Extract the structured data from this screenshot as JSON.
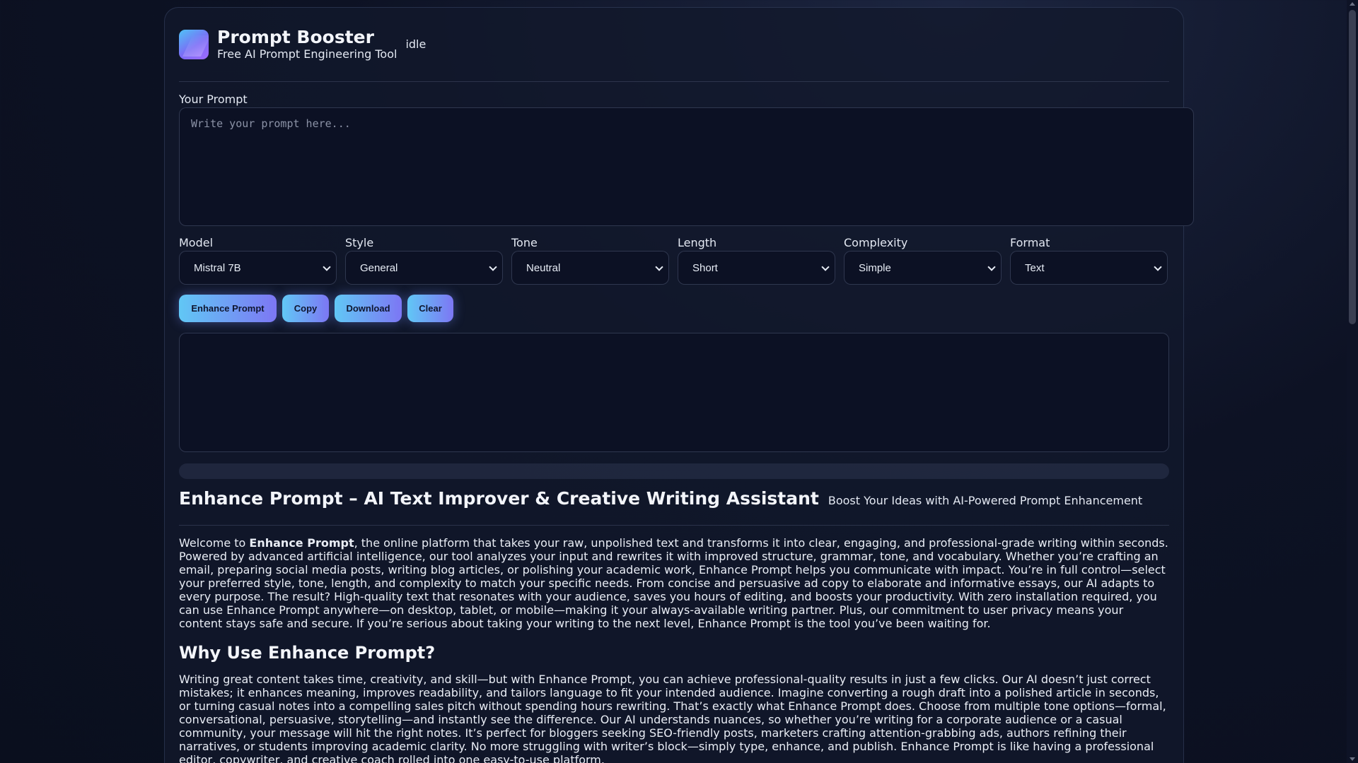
{
  "app": {
    "title": "Prompt Booster",
    "subtitle": "Free AI Prompt Engineering Tool",
    "status": "idle"
  },
  "prompt": {
    "label": "Your Prompt",
    "placeholder": "Write your prompt here...",
    "value": ""
  },
  "options": {
    "model": {
      "label": "Model",
      "value": "Mistral 7B"
    },
    "style": {
      "label": "Style",
      "value": "General"
    },
    "tone": {
      "label": "Tone",
      "value": "Neutral"
    },
    "length": {
      "label": "Length",
      "value": "Short"
    },
    "complexity": {
      "label": "Complexity",
      "value": "Simple"
    },
    "format": {
      "label": "Format",
      "value": "Text"
    }
  },
  "actions": {
    "enhance": "Enhance Prompt",
    "copy": "Copy",
    "download": "Download",
    "clear": "Clear"
  },
  "output": {
    "text": ""
  },
  "progress": {
    "percent": 0
  },
  "article": {
    "title": "Enhance Prompt – AI Text Improver & Creative Writing Assistant",
    "tagline": "Boost Your Ideas with AI-Powered Prompt Enhancement",
    "intro_prefix": "Welcome to ",
    "intro_brand": "Enhance Prompt",
    "intro_body": ", the online platform that takes your raw, unpolished text and transforms it into clear, engaging, and professional-grade writing within seconds. Powered by advanced artificial intelligence, our tool analyzes your input and rewrites it with improved structure, grammar, tone, and vocabulary. Whether you’re crafting an email, preparing social media posts, writing blog articles, or polishing your academic work, Enhance Prompt helps you communicate with impact. You’re in full control—select your preferred style, tone, length, and complexity to match your specific needs. From concise and persuasive ad copy to elaborate and informative essays, our AI adapts to every purpose. The result? High-quality text that resonates with your audience, saves you hours of editing, and boosts your productivity. With zero installation required, you can use Enhance Prompt anywhere—on desktop, tablet, or mobile—making it your always-available writing partner. Plus, our commitment to user privacy means your content stays safe and secure. If you’re serious about taking your writing to the next level, Enhance Prompt is the tool you’ve been waiting for.",
    "section_title": "Why Use Enhance Prompt?",
    "section_body": "Writing great content takes time, creativity, and skill—but with Enhance Prompt, you can achieve professional-quality results in just a few clicks. Our AI doesn’t just correct mistakes; it enhances meaning, improves readability, and tailors language to fit your intended audience. Imagine converting a rough draft into a polished article in seconds, or turning casual notes into a compelling sales pitch without spending hours rewriting. That’s exactly what Enhance Prompt does. Choose from multiple tone options—formal, conversational, persuasive, storytelling—and instantly see the difference. Our AI understands nuances, so whether you’re writing for a corporate audience or a casual community, your message will hit the right notes. It’s perfect for bloggers seeking SEO-friendly posts, marketers crafting attention-grabbing ads, authors refining their narratives, or students improving academic clarity. No more struggling with writer’s block—simply type, enhance, and publish. Enhance Prompt is like having a professional editor, copywriter, and creative coach rolled into one easy-to-use platform."
  },
  "colors": {
    "background": "#0a0f1e",
    "card": "#12182c",
    "accent_start": "#61c7f5",
    "accent_end": "#7d77f4"
  }
}
